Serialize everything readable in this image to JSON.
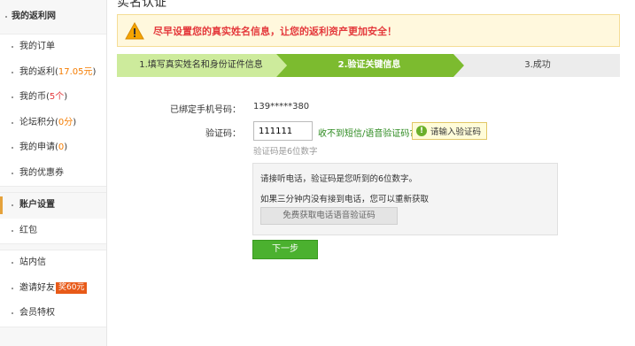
{
  "sidebar": {
    "header": "我的返利网",
    "groups": [
      {
        "items": [
          {
            "label": "我的订单"
          },
          {
            "label": "我的返利",
            "extra_open": "(",
            "extra_value": "17.05元",
            "extra_close": ")"
          },
          {
            "label": "我的币",
            "extra_open": "(",
            "extra_value": "5个",
            "extra_close": ")"
          },
          {
            "label": "论坛积分",
            "extra_open": "(",
            "extra_value": "0分",
            "extra_close": ")"
          },
          {
            "label": "我的申请",
            "extra_open": "(",
            "extra_value": "0",
            "extra_close": ")"
          },
          {
            "label": "我的优惠券"
          }
        ]
      },
      {
        "items": [
          {
            "label": "账户设置"
          },
          {
            "label": "红包"
          }
        ]
      },
      {
        "items": [
          {
            "label": "站内信"
          },
          {
            "label": "邀请好友",
            "badge": "奖60元"
          },
          {
            "label": "会员特权"
          }
        ]
      }
    ]
  },
  "page": {
    "title": "实名认证",
    "alert": "尽早设置您的真实姓名信息，让您的返利资产更加安全！"
  },
  "steps": [
    {
      "label": "1.填写真实姓名和身份证件信息",
      "state": "done"
    },
    {
      "label": "2.验证关键信息",
      "state": "current"
    },
    {
      "label": "3.成功",
      "state": "pending"
    }
  ],
  "colors": {
    "step_done": "#cdeb9c",
    "step_current": "#7cbb2f",
    "step_pending": "#ececec",
    "alert_text": "#e4393c",
    "primary_button": "#4bb12f"
  },
  "form": {
    "phone_label": "已绑定手机号码：",
    "phone_value": "139*****380",
    "code_label": "验证码：",
    "code_value": "111111",
    "resend_link": "收不到短信/语音验证码?",
    "tip": "请输入验证码",
    "hint": "验证码是6位数字",
    "voice_line1": "请接听电话，验证码是您听到的6位数字。",
    "voice_line2": "如果三分钟内没有接到电话，您可以重新获取",
    "voice_button": "免费获取电话语音验证码",
    "next_button": "下一步"
  }
}
